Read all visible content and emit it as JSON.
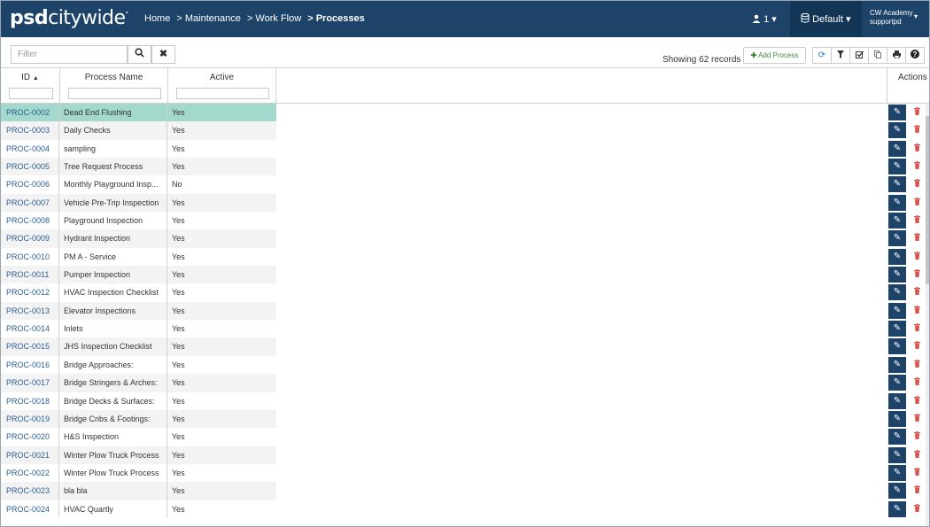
{
  "header": {
    "logo_bold": "psd",
    "logo_rest": "citywide",
    "logo_mark": ".",
    "breadcrumb": [
      "Home",
      "> Maintenance",
      "> Work Flow"
    ],
    "breadcrumb_current": "> Processes",
    "user_count": "1",
    "workspace": "Default",
    "account_org": "CW Academy",
    "account_user": "supportpd"
  },
  "toolbar": {
    "filter_placeholder": "Filter",
    "showing": "Showing 62 records",
    "add_label": "Add Process"
  },
  "table": {
    "columns": [
      "ID",
      "Process Name",
      "Active"
    ],
    "actions_header": "Actions",
    "rows": [
      {
        "id": "PROC-0002",
        "name": "Dead End Flushing",
        "active": "Yes"
      },
      {
        "id": "PROC-0003",
        "name": "Daily Checks",
        "active": "Yes"
      },
      {
        "id": "PROC-0004",
        "name": "sampling",
        "active": "Yes"
      },
      {
        "id": "PROC-0005",
        "name": "Tree Request Process",
        "active": "Yes"
      },
      {
        "id": "PROC-0006",
        "name": "Monthly Playground Insp...",
        "active": "No"
      },
      {
        "id": "PROC-0007",
        "name": "Vehicle Pre-Trip Inspection",
        "active": "Yes"
      },
      {
        "id": "PROC-0008",
        "name": "Playground Inspection",
        "active": "Yes"
      },
      {
        "id": "PROC-0009",
        "name": "Hydrant Inspection",
        "active": "Yes"
      },
      {
        "id": "PROC-0010",
        "name": "PM A - Service",
        "active": "Yes"
      },
      {
        "id": "PROC-0011",
        "name": "Pumper Inspection",
        "active": "Yes"
      },
      {
        "id": "PROC-0012",
        "name": "HVAC Inspection Checklist",
        "active": "Yes"
      },
      {
        "id": "PROC-0013",
        "name": "Elevator Inspections",
        "active": "Yes"
      },
      {
        "id": "PROC-0014",
        "name": "Inlets",
        "active": "Yes"
      },
      {
        "id": "PROC-0015",
        "name": "JHS Inspection Checklist",
        "active": "Yes"
      },
      {
        "id": "PROC-0016",
        "name": "Bridge Approaches:",
        "active": "Yes"
      },
      {
        "id": "PROC-0017",
        "name": "Bridge Stringers & Arches:",
        "active": "Yes"
      },
      {
        "id": "PROC-0018",
        "name": "Bridge Decks & Surfaces:",
        "active": "Yes"
      },
      {
        "id": "PROC-0019",
        "name": "Bridge Cribs & Footings:",
        "active": "Yes"
      },
      {
        "id": "PROC-0020",
        "name": "H&S Inspection",
        "active": "Yes"
      },
      {
        "id": "PROC-0021",
        "name": "Winter Plow Truck Process",
        "active": "Yes"
      },
      {
        "id": "PROC-0022",
        "name": "Winter Plow Truck Process",
        "active": "Yes"
      },
      {
        "id": "PROC-0023",
        "name": "bla bla",
        "active": "Yes"
      },
      {
        "id": "PROC-0024",
        "name": "HVAC Quartly",
        "active": "Yes"
      }
    ]
  },
  "colors": {
    "header_bg": "#1d4368",
    "selected_row": "#a2d9cc",
    "link": "#2b5f94",
    "delete": "#d9534f"
  }
}
